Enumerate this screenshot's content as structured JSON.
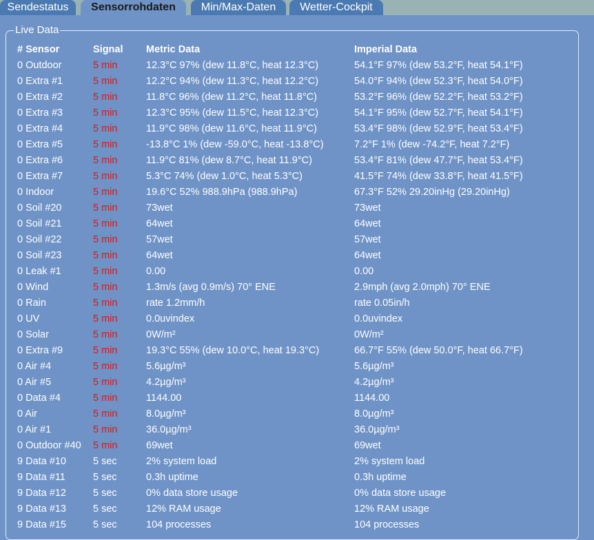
{
  "tabs": [
    {
      "label": "Sendestatus",
      "active": false
    },
    {
      "label": "Sensorrohdaten",
      "active": true
    },
    {
      "label": "Min/Max-Daten",
      "active": false
    },
    {
      "label": "Wetter-Cockpit",
      "active": false
    }
  ],
  "colors": {
    "background": "#6f93c6",
    "tab": "#4a7ab1",
    "tab_bar": "#99b3b4",
    "signal_stale": "#d11a1a"
  },
  "live": {
    "legend": "Live Data",
    "headers": {
      "sensor": "# Sensor",
      "signal": "Signal",
      "metric": "Metric Data",
      "imperial": "Imperial Data"
    },
    "rows": [
      {
        "sensor": "0 Outdoor",
        "signal": "5 min",
        "stale": true,
        "metric": "12.3°C 97% (dew 11.8°C, heat 12.3°C)",
        "imperial": "54.1°F 97% (dew 53.2°F, heat 54.1°F)"
      },
      {
        "sensor": "0 Extra #1",
        "signal": "5 min",
        "stale": true,
        "metric": "12.2°C 94% (dew 11.3°C, heat 12.2°C)",
        "imperial": "54.0°F 94% (dew 52.3°F, heat 54.0°F)"
      },
      {
        "sensor": "0 Extra #2",
        "signal": "5 min",
        "stale": true,
        "metric": "11.8°C 96% (dew 11.2°C, heat 11.8°C)",
        "imperial": "53.2°F 96% (dew 52.2°F, heat 53.2°F)"
      },
      {
        "sensor": "0 Extra #3",
        "signal": "5 min",
        "stale": true,
        "metric": "12.3°C 95% (dew 11.5°C, heat 12.3°C)",
        "imperial": "54.1°F 95% (dew 52.7°F, heat 54.1°F)"
      },
      {
        "sensor": "0 Extra #4",
        "signal": "5 min",
        "stale": true,
        "metric": "11.9°C 98% (dew 11.6°C, heat 11.9°C)",
        "imperial": "53.4°F 98% (dew 52.9°F, heat 53.4°F)"
      },
      {
        "sensor": "0 Extra #5",
        "signal": "5 min",
        "stale": true,
        "metric": "-13.8°C 1% (dew -59.0°C, heat -13.8°C)",
        "imperial": "7.2°F 1% (dew -74.2°F, heat 7.2°F)"
      },
      {
        "sensor": "0 Extra #6",
        "signal": "5 min",
        "stale": true,
        "metric": "11.9°C 81% (dew 8.7°C, heat 11.9°C)",
        "imperial": "53.4°F 81% (dew 47.7°F, heat 53.4°F)"
      },
      {
        "sensor": "0 Extra #7",
        "signal": "5 min",
        "stale": true,
        "metric": "5.3°C 74% (dew 1.0°C, heat 5.3°C)",
        "imperial": "41.5°F 74% (dew 33.8°F, heat 41.5°F)"
      },
      {
        "sensor": "0 Indoor",
        "signal": "5 min",
        "stale": true,
        "metric": "19.6°C 52% 988.9hPa (988.9hPa)",
        "imperial": "67.3°F 52% 29.20inHg (29.20inHg)"
      },
      {
        "sensor": "0 Soil #20",
        "signal": "5 min",
        "stale": true,
        "metric": "73wet",
        "imperial": "73wet"
      },
      {
        "sensor": "0 Soil #21",
        "signal": "5 min",
        "stale": true,
        "metric": "64wet",
        "imperial": "64wet"
      },
      {
        "sensor": "0 Soil #22",
        "signal": "5 min",
        "stale": true,
        "metric": "57wet",
        "imperial": "57wet"
      },
      {
        "sensor": "0 Soil #23",
        "signal": "5 min",
        "stale": true,
        "metric": "64wet",
        "imperial": "64wet"
      },
      {
        "sensor": "0 Leak #1",
        "signal": "5 min",
        "stale": true,
        "metric": "0.00",
        "imperial": "0.00"
      },
      {
        "sensor": "0 Wind",
        "signal": "5 min",
        "stale": true,
        "metric": "1.3m/s (avg 0.9m/s) 70° ENE",
        "imperial": "2.9mph (avg 2.0mph) 70° ENE"
      },
      {
        "sensor": "0 Rain",
        "signal": "5 min",
        "stale": true,
        "metric": "rate 1.2mm/h",
        "imperial": "rate 0.05in/h"
      },
      {
        "sensor": "0 UV",
        "signal": "5 min",
        "stale": true,
        "metric": "0.0uvindex",
        "imperial": "0.0uvindex"
      },
      {
        "sensor": "0 Solar",
        "signal": "5 min",
        "stale": true,
        "metric": "0W/m²",
        "imperial": "0W/m²"
      },
      {
        "sensor": "0 Extra #9",
        "signal": "5 min",
        "stale": true,
        "metric": "19.3°C 55% (dew 10.0°C, heat 19.3°C)",
        "imperial": "66.7°F 55% (dew 50.0°F, heat 66.7°F)"
      },
      {
        "sensor": "0 Air #4",
        "signal": "5 min",
        "stale": true,
        "metric": "5.6µg/m³",
        "imperial": "5.6µg/m³"
      },
      {
        "sensor": "0 Air #5",
        "signal": "5 min",
        "stale": true,
        "metric": "4.2µg/m³",
        "imperial": "4.2µg/m³"
      },
      {
        "sensor": "0 Data #4",
        "signal": "5 min",
        "stale": true,
        "metric": "1144.00",
        "imperial": "1144.00"
      },
      {
        "sensor": "0 Air",
        "signal": "5 min",
        "stale": true,
        "metric": "8.0µg/m³",
        "imperial": "8.0µg/m³"
      },
      {
        "sensor": "0 Air #1",
        "signal": "5 min",
        "stale": true,
        "metric": "36.0µg/m³",
        "imperial": "36.0µg/m³"
      },
      {
        "sensor": "0 Outdoor #40",
        "signal": "5 min",
        "stale": true,
        "metric": "69wet",
        "imperial": "69wet"
      },
      {
        "sensor": "9 Data #10",
        "signal": "5 sec",
        "stale": false,
        "metric": "2% system load",
        "imperial": "2% system load"
      },
      {
        "sensor": "9 Data #11",
        "signal": "5 sec",
        "stale": false,
        "metric": "0.3h uptime",
        "imperial": "0.3h uptime"
      },
      {
        "sensor": "9 Data #12",
        "signal": "5 sec",
        "stale": false,
        "metric": "0% data store usage",
        "imperial": "0% data store usage"
      },
      {
        "sensor": "9 Data #13",
        "signal": "5 sec",
        "stale": false,
        "metric": "12% RAM usage",
        "imperial": "12% RAM usage"
      },
      {
        "sensor": "9 Data #15",
        "signal": "5 sec",
        "stale": false,
        "metric": "104 processes",
        "imperial": "104 processes"
      }
    ]
  }
}
